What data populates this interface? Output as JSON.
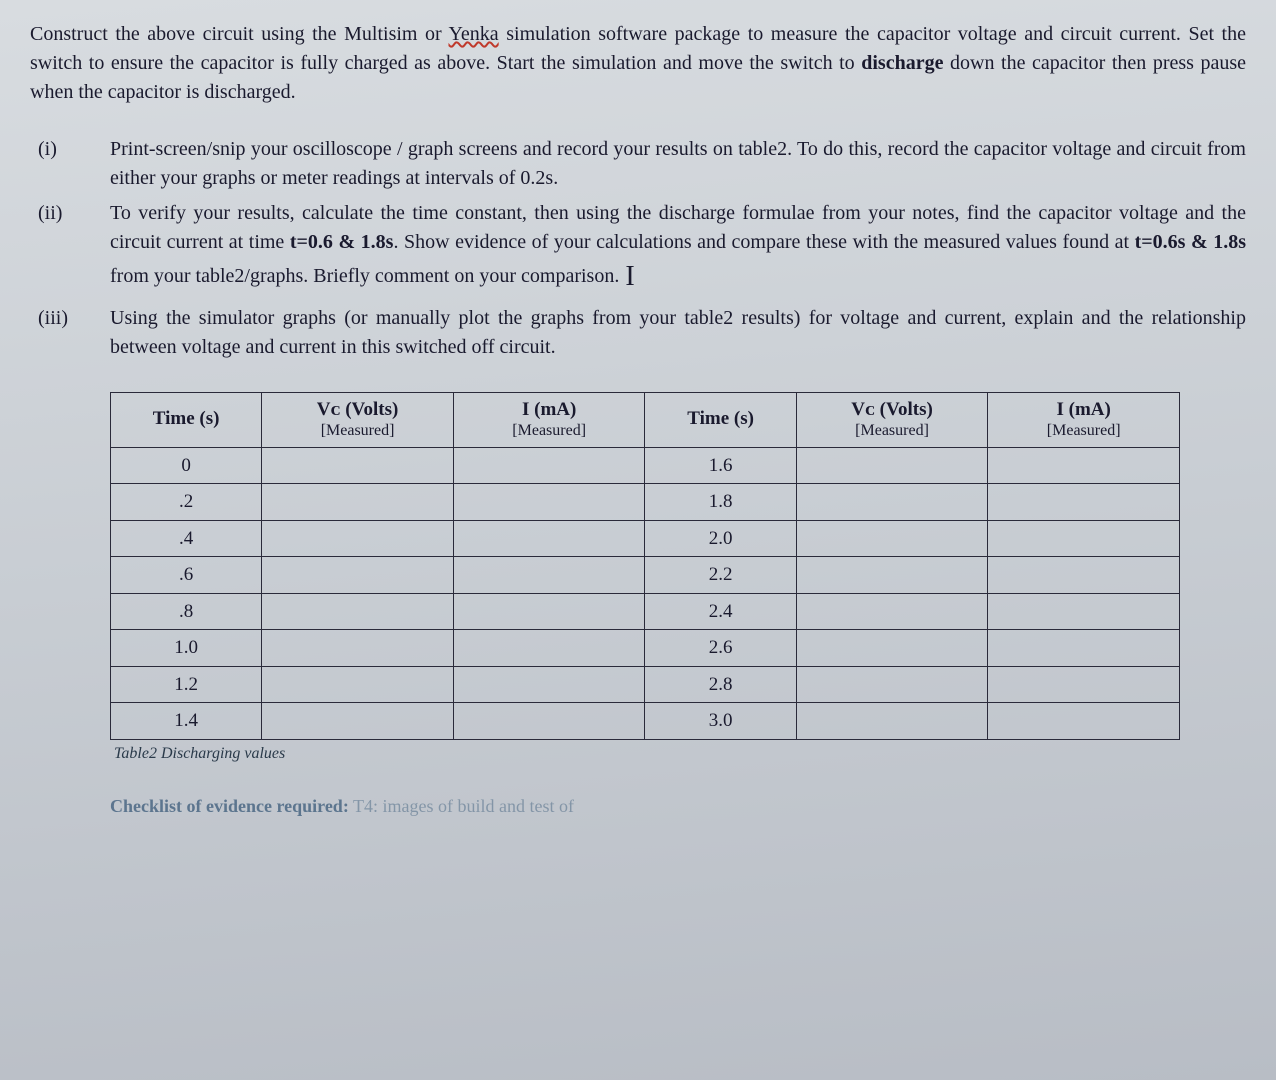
{
  "intro": {
    "pre": "Construct the above circuit using the Multisim or ",
    "yenka": "Yenka",
    "mid": " simulation software package to measure the capacitor voltage and circuit current. Set the switch to ensure the capacitor is fully charged as above. Start the simulation and move the switch to ",
    "discharge": "discharge",
    "post": " down the capacitor then press pause when the capacitor is discharged."
  },
  "items": [
    {
      "marker": "(i)",
      "text": "Print-screen/snip your oscilloscope / graph screens and record your results on table2.  To do this, record the capacitor voltage and circuit from either your graphs or meter readings at intervals of 0.2s."
    },
    {
      "marker": "(ii)",
      "pre": "To verify your results, calculate the time constant, then using the discharge formulae from your notes, find the capacitor voltage and the circuit current at time ",
      "b1": "t=0.6 & 1.8s",
      "mid": ".  Show evidence of your calculations and compare these with the measured values found at ",
      "b2": "t=0.6s & 1.8s",
      "post": " from your table2/graphs. Briefly comment on your comparison."
    },
    {
      "marker": "(iii)",
      "text": "Using the simulator graphs (or manually plot the graphs from your table2 results) for voltage and current, explain and the relationship between voltage and current in this switched off circuit."
    }
  ],
  "table": {
    "headers": {
      "time": "Time (s)",
      "vc": "Vᴄ (Volts)",
      "vc_sub": "[Measured]",
      "i": "I (mA)",
      "i_sub": "[Measured]"
    },
    "left_rows": [
      "0",
      ".2",
      ".4",
      ".6",
      ".8",
      "1.0",
      "1.2",
      "1.4"
    ],
    "right_rows": [
      "1.6",
      "1.8",
      "2.0",
      "2.2",
      "2.4",
      "2.6",
      "2.8",
      "3.0"
    ],
    "caption": "Table2 Discharging values"
  },
  "checklist": {
    "label": "Checklist of evidence required:",
    "faded": " T4: images of build and test of"
  },
  "cursor": "I"
}
